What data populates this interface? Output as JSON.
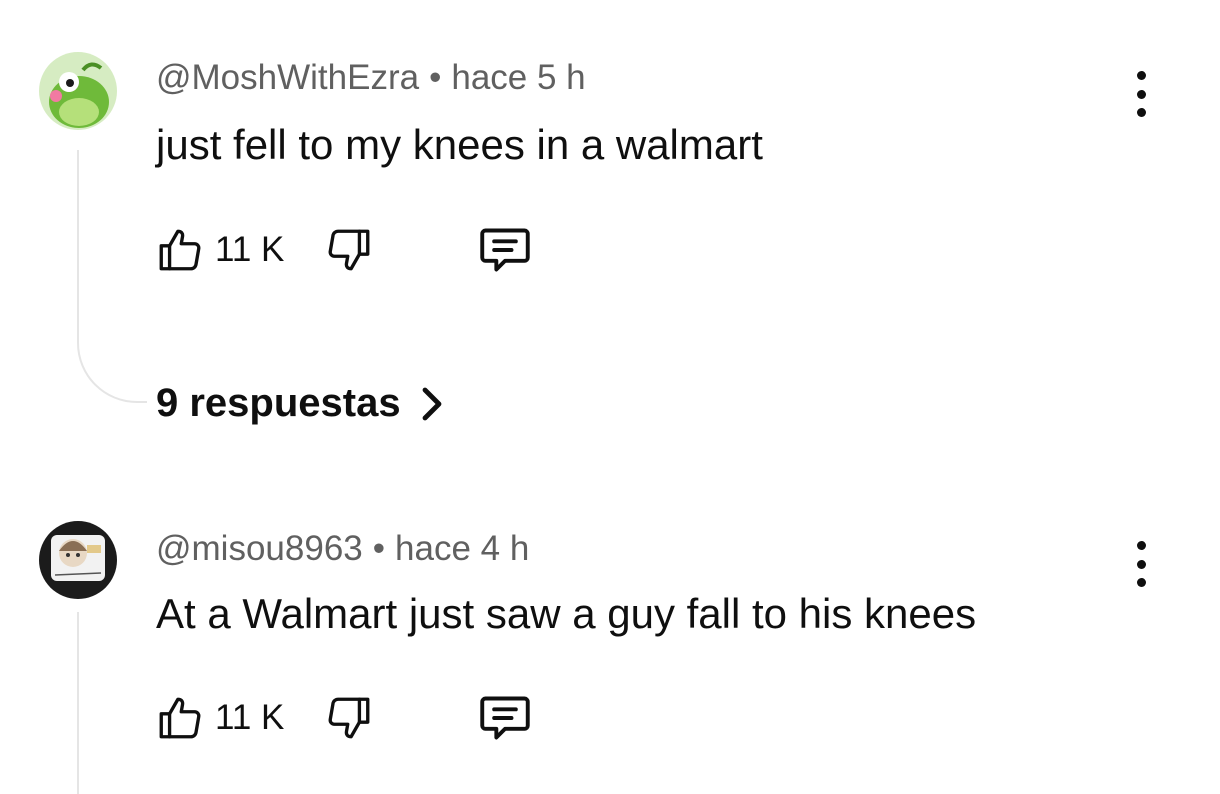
{
  "comments": [
    {
      "author": "@MoshWithEzra",
      "separator": "•",
      "time": "hace 5 h",
      "text": "just fell to my knees in a walmart",
      "likes": "11 K",
      "replies": "9 respuestas"
    },
    {
      "author": "@misou8963",
      "separator": "•",
      "time": "hace 4 h",
      "text": "At a Walmart just saw a guy fall to his knees",
      "likes": "11 K"
    }
  ],
  "icons": {
    "like": "thumb-up-icon",
    "dislike": "thumb-down-icon",
    "reply": "comment-icon",
    "more": "more-vertical-icon",
    "expand": "chevron-right-icon"
  }
}
